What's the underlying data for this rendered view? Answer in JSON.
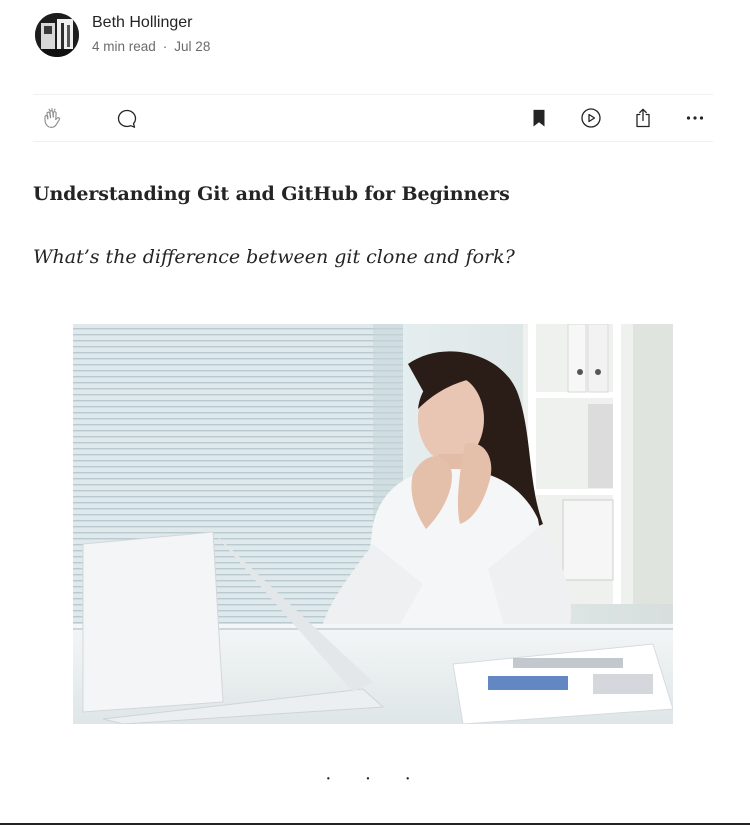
{
  "author": {
    "name": "Beth Hollinger",
    "read_time": "4 min read",
    "separator": "·",
    "date": "Jul 28"
  },
  "actions": {
    "icons": [
      "clap-icon",
      "comment-icon",
      "bookmark-icon",
      "listen-icon",
      "share-icon",
      "more-icon"
    ]
  },
  "article": {
    "title": "Understanding Git and GitHub for Beginners",
    "subtitle": "What’s the difference between git clone and fork?",
    "image_alt": "Woman at desk looking worried at laptop",
    "section_break": "· · ·"
  },
  "colors": {
    "text": "#242424",
    "muted": "#6b6b6b",
    "divider": "#f0f0f0"
  }
}
